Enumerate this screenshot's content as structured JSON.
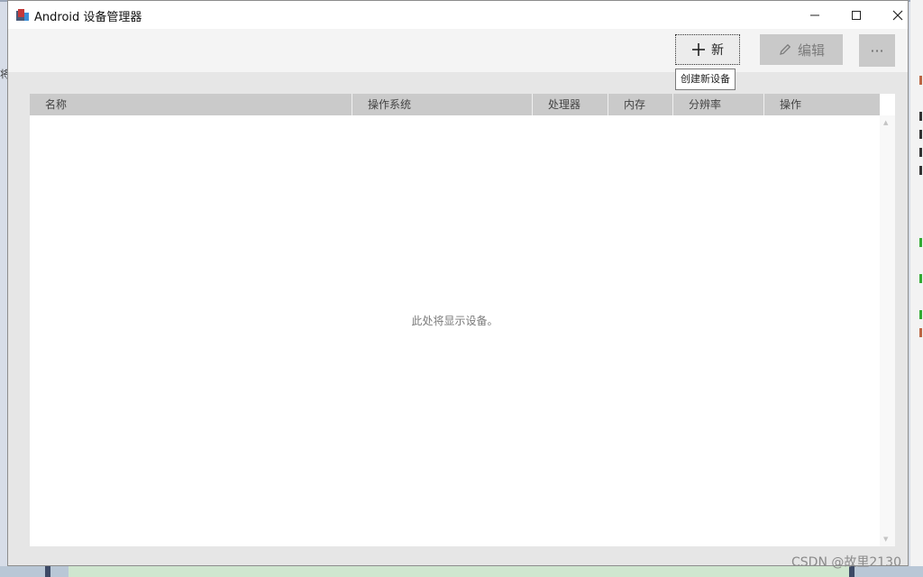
{
  "window": {
    "title": "Android 设备管理器"
  },
  "toolbar": {
    "new_label": "新",
    "edit_label": "编辑",
    "more_label": "···",
    "new_tooltip": "创建新设备"
  },
  "table": {
    "columns": [
      "名称",
      "操作系统",
      "处理器",
      "内存",
      "分辨率",
      "操作"
    ],
    "empty_message": "此处将显示设备。"
  },
  "background": {
    "left_fragment": "将"
  },
  "watermark": "CSDN @故里2130"
}
